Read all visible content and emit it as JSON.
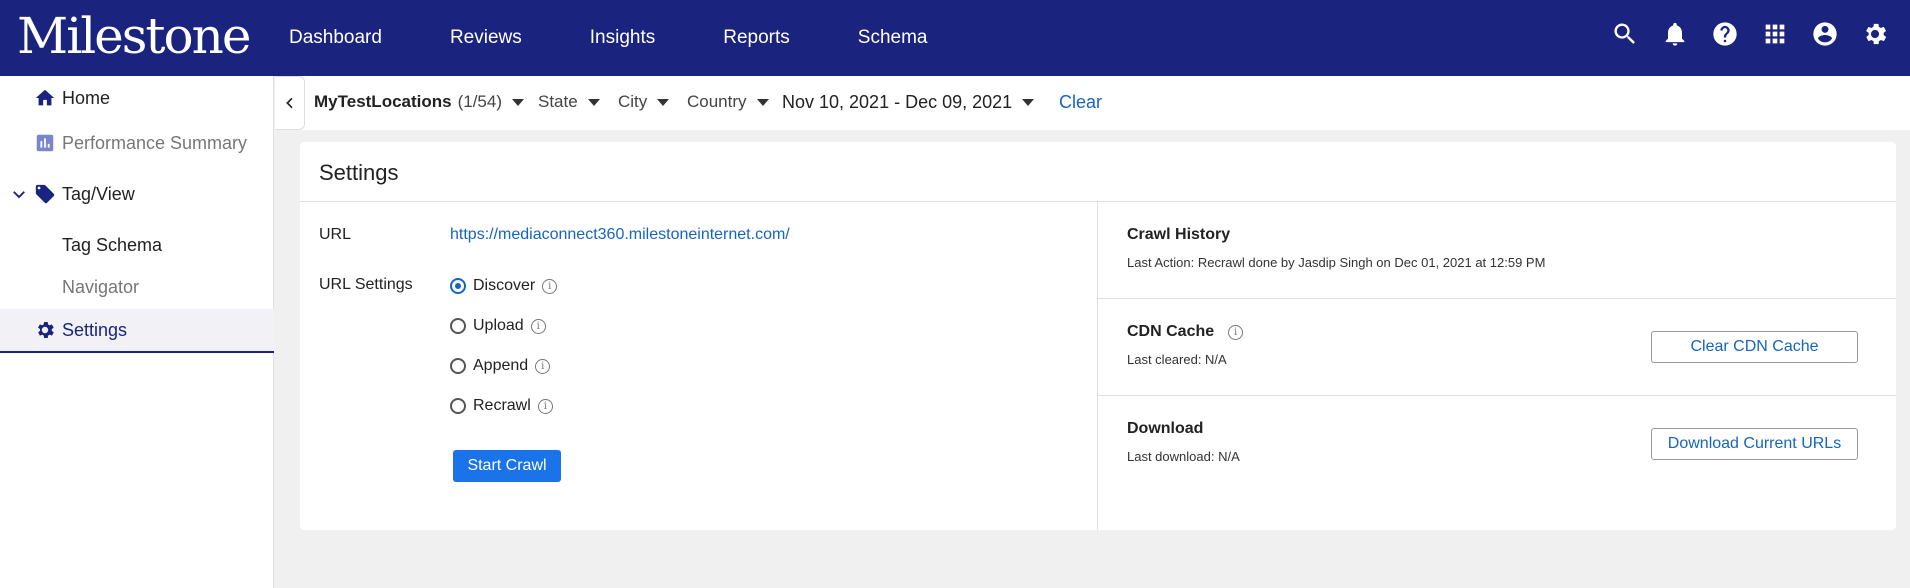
{
  "app": {
    "logo": "Milestone"
  },
  "nav": [
    "Dashboard",
    "Reviews",
    "Insights",
    "Reports",
    "Schema"
  ],
  "sidebar": {
    "items": [
      {
        "label": "Home",
        "icon": "home-icon"
      },
      {
        "label": "Performance Summary",
        "icon": "bar-chart-icon"
      },
      {
        "label": "Tag/View",
        "icon": "tag-icon"
      },
      {
        "label": "Tag Schema"
      },
      {
        "label": "Navigator"
      },
      {
        "label": "Settings",
        "icon": "gear-icon"
      }
    ]
  },
  "filters": {
    "location": "MyTestLocations",
    "location_count": "(1/54)",
    "state": "State",
    "city": "City",
    "country": "Country",
    "date_range": "Nov 10, 2021 - Dec 09, 2021",
    "clear": "Clear"
  },
  "settings": {
    "title": "Settings",
    "url_label": "URL",
    "url_value": "https://mediaconnect360.milestoneinternet.com/",
    "url_settings_label": "URL Settings",
    "options": [
      "Discover",
      "Upload",
      "Append",
      "Recrawl"
    ],
    "selected_option": "Discover",
    "start_button": "Start Crawl",
    "crawl_history": {
      "title": "Crawl History",
      "last_action": "Last Action: Recrawl done by Jasdip Singh on Dec 01, 2021 at 12:59 PM"
    },
    "cdn_cache": {
      "title": "CDN Cache",
      "last_cleared": "Last cleared: N/A",
      "button": "Clear CDN Cache"
    },
    "download": {
      "title": "Download",
      "last_download": "Last download: N/A",
      "button": "Download Current URLs"
    }
  },
  "colors": {
    "brand": "#1a237e",
    "link": "#1565c0",
    "primary_button": "#1a73e8"
  }
}
